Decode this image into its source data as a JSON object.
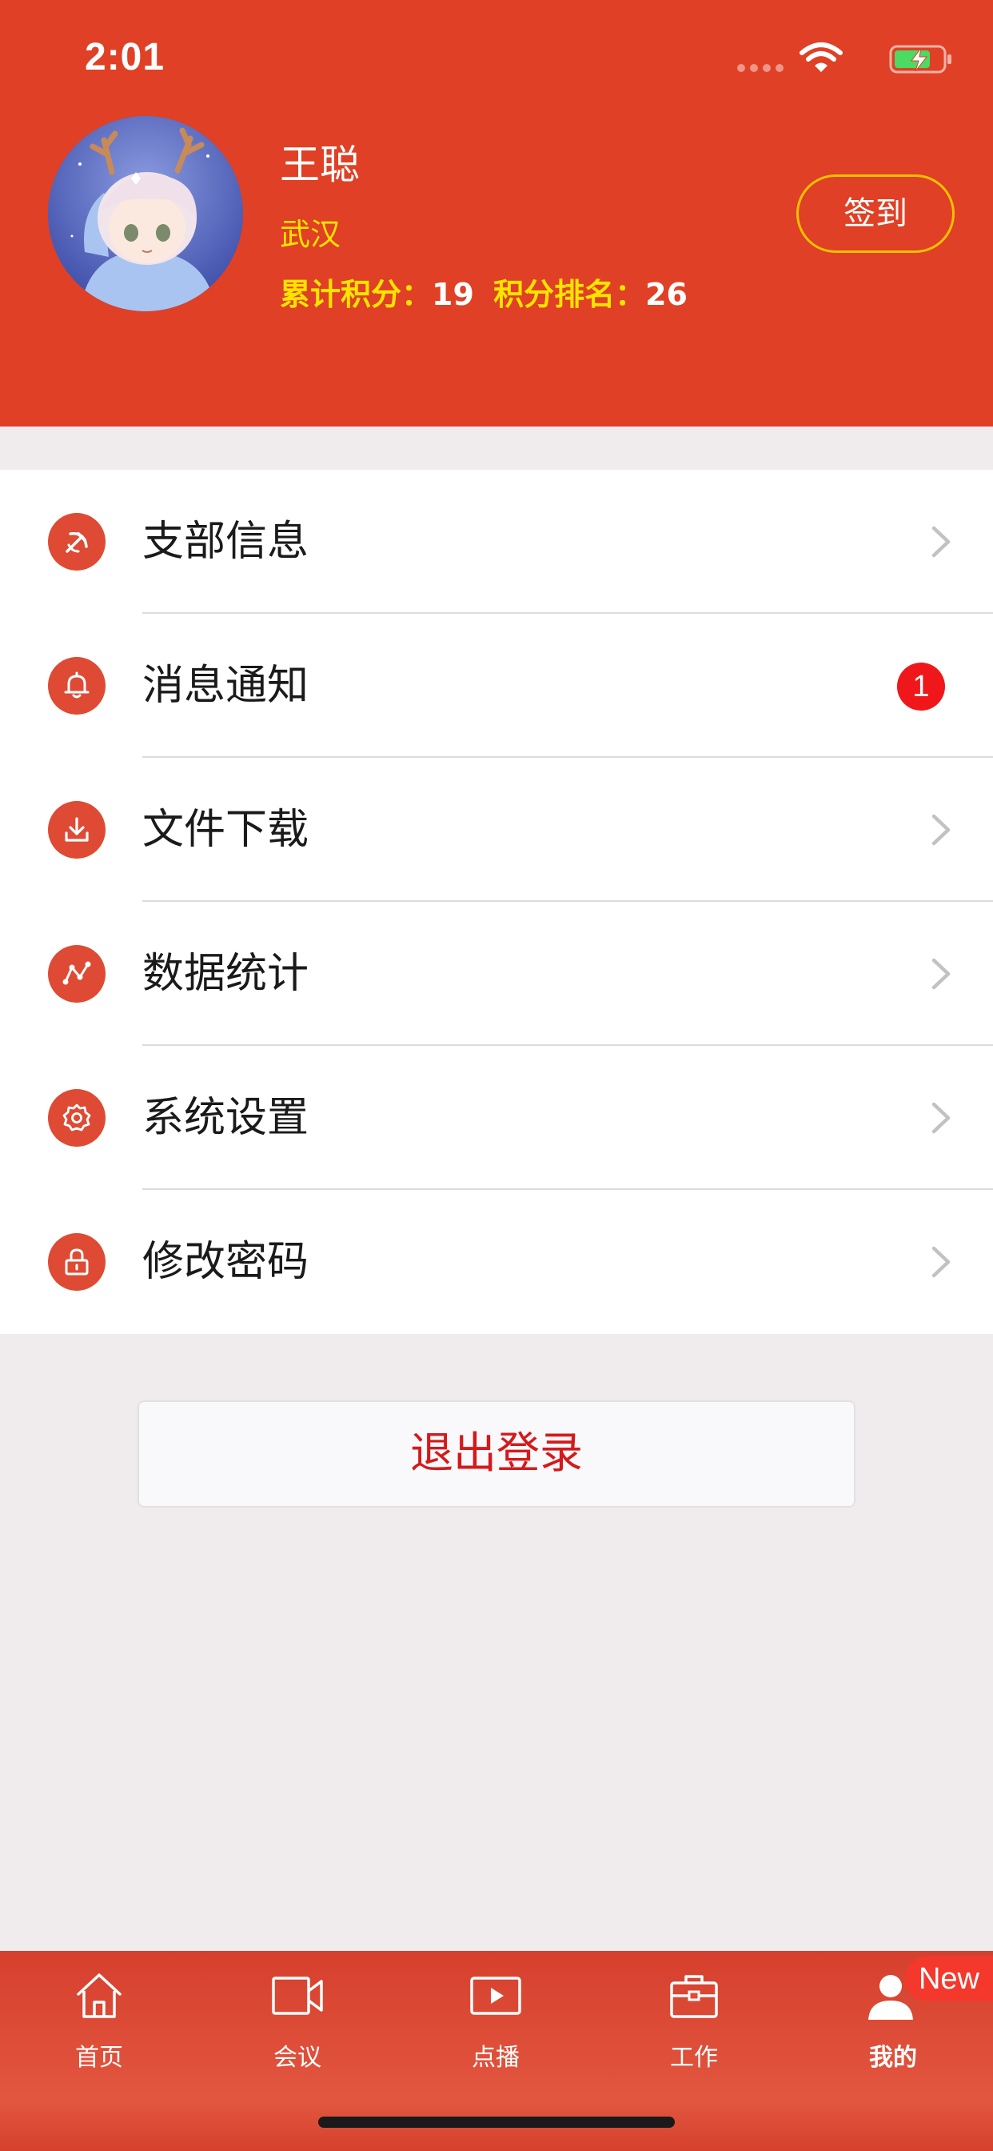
{
  "status_bar": {
    "time": "2:01",
    "icons": [
      "signal-icon",
      "wifi-icon",
      "battery-charging-icon"
    ]
  },
  "profile": {
    "name": "王聪",
    "city": "武汉",
    "points_label": "累计积分：",
    "points_value": "19",
    "rank_label": "积分排名：",
    "rank_value": "26",
    "checkin_label": "签到"
  },
  "menu": {
    "items": [
      {
        "label": "支部信息",
        "icon": "party-emblem-icon"
      },
      {
        "label": "消息通知",
        "icon": "bell-icon",
        "badge": "1"
      },
      {
        "label": "文件下载",
        "icon": "download-icon"
      },
      {
        "label": "数据统计",
        "icon": "statistics-icon"
      },
      {
        "label": "系统设置",
        "icon": "gear-icon"
      },
      {
        "label": "修改密码",
        "icon": "lock-icon"
      }
    ]
  },
  "logout_label": "退出登录",
  "tabbar": {
    "tabs": [
      {
        "label": "首页",
        "icon": "home-icon"
      },
      {
        "label": "会议",
        "icon": "video-camera-icon"
      },
      {
        "label": "点播",
        "icon": "play-icon"
      },
      {
        "label": "工作",
        "icon": "briefcase-icon"
      },
      {
        "label": "我的",
        "icon": "person-icon"
      }
    ],
    "new_badge": "New"
  },
  "colors": {
    "header": "#e04025",
    "accent_yellow": "#ffe400",
    "icon_red": "#de4a33",
    "logout_red": "#d5191a"
  }
}
